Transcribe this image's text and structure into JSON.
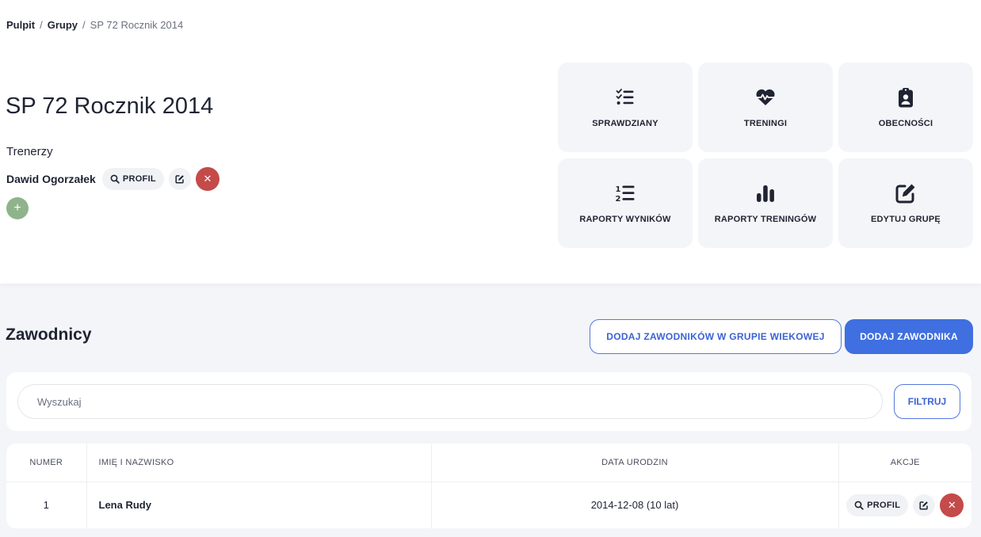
{
  "breadcrumb": {
    "items": [
      "Pulpit",
      "Grupy"
    ],
    "current": "SP 72 Rocznik 2014",
    "separator": "/"
  },
  "group": {
    "title": "SP 72 Rocznik 2014",
    "trainers_heading": "Trenerzy",
    "trainers": [
      {
        "name": "Dawid Ogorzałek",
        "profile_label": "PROFIL"
      }
    ]
  },
  "tiles": [
    {
      "label": "SPRAWDZIANY",
      "icon": "checklist-icon"
    },
    {
      "label": "TRENINGI",
      "icon": "heart-pulse-icon"
    },
    {
      "label": "OBECNOŚCI",
      "icon": "clipboard-user-icon"
    },
    {
      "label": "RAPORTY WYNIKÓW",
      "icon": "numbered-list-icon"
    },
    {
      "label": "RAPORTY TRENINGÓW",
      "icon": "bar-chart-icon"
    },
    {
      "label": "EDYTUJ GRUPĘ",
      "icon": "edit-icon"
    }
  ],
  "players": {
    "title": "Zawodnicy",
    "add_age_group_label": "DODAJ ZAWODNIKÓW W GRUPIE WIEKOWEJ",
    "add_player_label": "DODAJ ZAWODNIKA",
    "search_placeholder": "Wyszukaj",
    "filter_label": "FILTRUJ",
    "columns": [
      "NUMER",
      "IMIĘ I NAZWISKO",
      "DATA URODZIN",
      "AKCJE"
    ],
    "rows": [
      {
        "number": "1",
        "name": "Lena Rudy",
        "birth": "2014-12-08 (10 lat)",
        "profile_label": "PROFIL"
      }
    ]
  },
  "colors": {
    "primary": "#3f6fe0",
    "danger": "#c54a4a",
    "success": "#8fb48c",
    "text": "#1f2433"
  }
}
